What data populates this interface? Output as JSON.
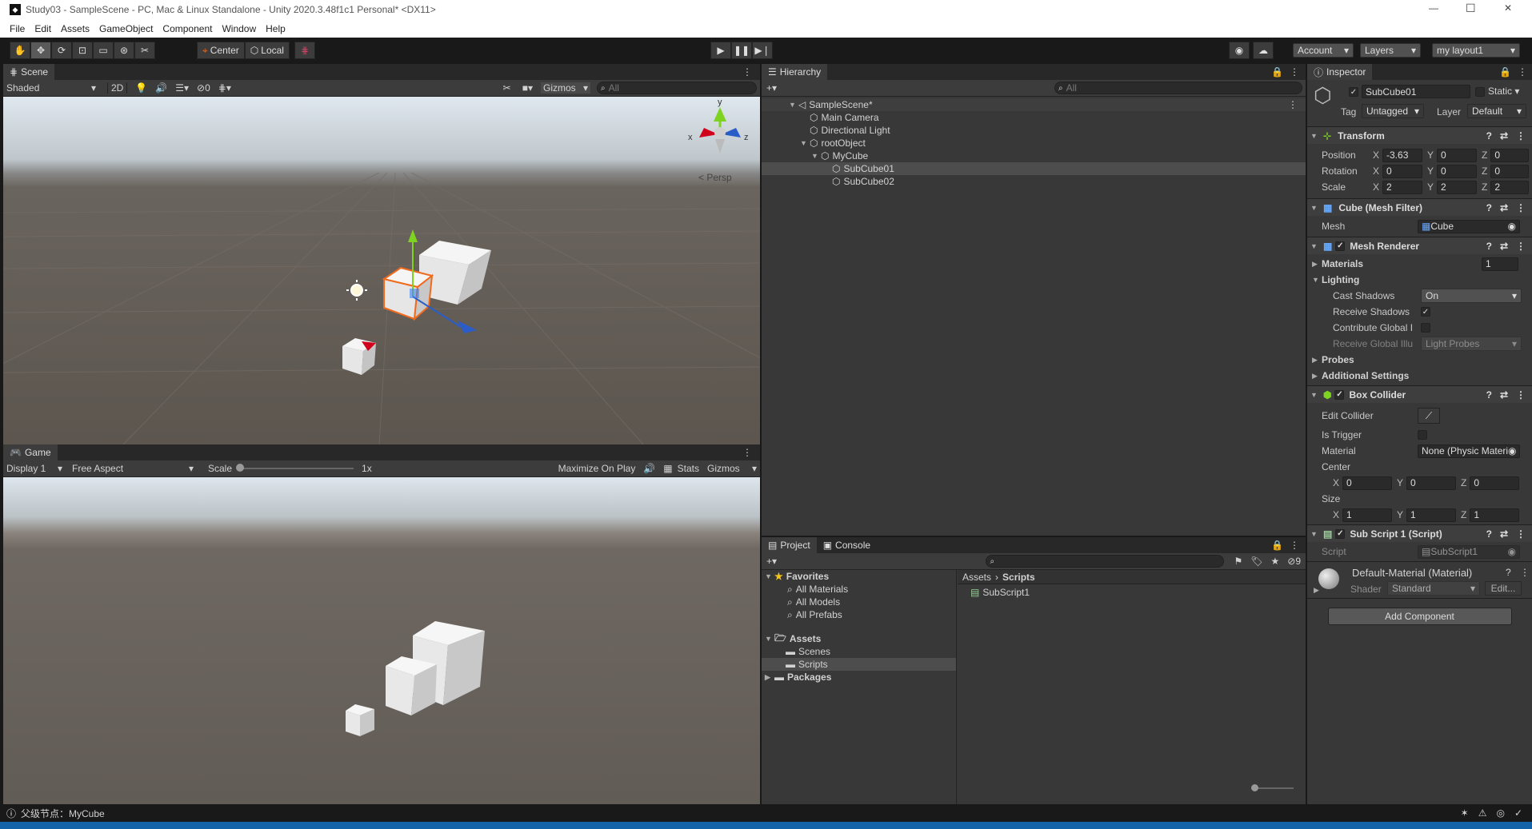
{
  "window": {
    "title": "Study03 - SampleScene - PC, Mac & Linux Standalone - Unity 2020.3.48f1c1 Personal* <DX11>",
    "minimize": "—",
    "maximize": "☐",
    "close": "✕"
  },
  "menu": [
    "File",
    "Edit",
    "Assets",
    "GameObject",
    "Component",
    "Window",
    "Help"
  ],
  "toolbar": {
    "center_label": "Center",
    "local_label": "Local",
    "account_label": "Account",
    "layers_label": "Layers",
    "layout_label": "my layout1"
  },
  "scene": {
    "tab": "Scene",
    "shading": "Shaded",
    "mode_2d": "2D",
    "hidden_count": "0",
    "gizmos": "Gizmos",
    "search_placeholder": "All",
    "persp_label": "< Persp",
    "axis_x": "x",
    "axis_y": "y",
    "axis_z": "z"
  },
  "game": {
    "tab": "Game",
    "display": "Display 1",
    "aspect": "Free Aspect",
    "scale_label": "Scale",
    "scale_value": "1x",
    "maximize": "Maximize On Play",
    "stats": "Stats",
    "gizmos": "Gizmos"
  },
  "hierarchy": {
    "tab": "Hierarchy",
    "search_placeholder": "All",
    "scene": "SampleScene*",
    "items": [
      {
        "label": "Main Camera",
        "depth": 1,
        "selected": false
      },
      {
        "label": "Directional Light",
        "depth": 1,
        "selected": false
      },
      {
        "label": "rootObject",
        "depth": 1,
        "selected": false,
        "expanded": true
      },
      {
        "label": "MyCube",
        "depth": 2,
        "selected": false,
        "expanded": true
      },
      {
        "label": "SubCube01",
        "depth": 3,
        "selected": true
      },
      {
        "label": "SubCube02",
        "depth": 3,
        "selected": false
      }
    ]
  },
  "project": {
    "tab_project": "Project",
    "tab_console": "Console",
    "hidden_count": "9",
    "favorites": "Favorites",
    "fav_items": [
      "All Materials",
      "All Models",
      "All Prefabs"
    ],
    "assets": "Assets",
    "asset_folders": [
      "Scenes",
      "Scripts"
    ],
    "packages": "Packages",
    "breadcrumb_root": "Assets",
    "breadcrumb_current": "Scripts",
    "files": [
      "SubScript1"
    ]
  },
  "inspector": {
    "tab": "Inspector",
    "object_name": "SubCube01",
    "static_label": "Static",
    "tag_label": "Tag",
    "tag_value": "Untagged",
    "layer_label": "Layer",
    "layer_value": "Default",
    "transform": {
      "title": "Transform",
      "position_label": "Position",
      "rotation_label": "Rotation",
      "scale_label": "Scale",
      "position": [
        "-3.63",
        "0",
        "0"
      ],
      "rotation": [
        "0",
        "0",
        "0"
      ],
      "scale": [
        "2",
        "2",
        "2"
      ]
    },
    "mesh_filter": {
      "title": "Cube (Mesh Filter)",
      "mesh_label": "Mesh",
      "mesh_value": "Cube"
    },
    "mesh_renderer": {
      "title": "Mesh Renderer",
      "materials_label": "Materials",
      "materials_count": "1",
      "lighting_label": "Lighting",
      "cast_shadows_label": "Cast Shadows",
      "cast_shadows_value": "On",
      "receive_shadows_label": "Receive Shadows",
      "contribute_gi_label": "Contribute Global I",
      "receive_gi_label": "Receive Global Illu",
      "receive_gi_value": "Light Probes",
      "probes_label": "Probes",
      "additional_label": "Additional Settings"
    },
    "box_collider": {
      "title": "Box Collider",
      "edit_label": "Edit Collider",
      "trigger_label": "Is Trigger",
      "material_label": "Material",
      "material_value": "None (Physic Materi",
      "center_label": "Center",
      "center": [
        "0",
        "0",
        "0"
      ],
      "size_label": "Size",
      "size": [
        "1",
        "1",
        "1"
      ]
    },
    "script": {
      "title": "Sub Script 1 (Script)",
      "script_label": "Script",
      "script_value": "SubScript1"
    },
    "material": {
      "name": "Default-Material (Material)",
      "shader_label": "Shader",
      "shader_value": "Standard",
      "edit": "Edit..."
    },
    "add_component": "Add Component"
  },
  "status": {
    "text": "父级节点：MyCube"
  },
  "colors": {
    "selection": "#2c5d87",
    "accent_orange": "#f06a1e",
    "background": "#383838"
  }
}
